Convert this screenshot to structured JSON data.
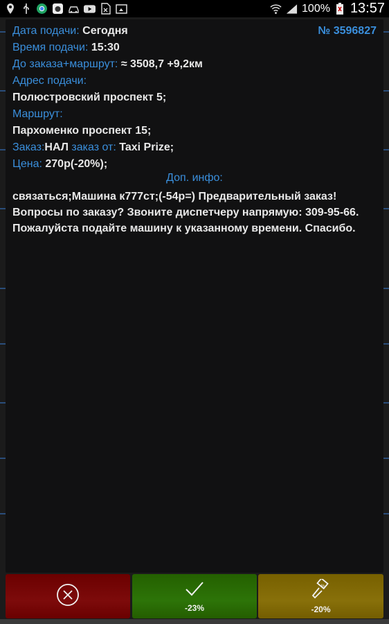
{
  "status_bar": {
    "battery": "100%",
    "time": "13:57"
  },
  "order": {
    "date_label": "Дата подачи:",
    "date_value": "Сегодня",
    "order_number": "№ 3596827",
    "time_label": "Время подачи:",
    "time_value": "15:30",
    "distance_label": "До заказа+маршрут:",
    "distance_value": "≈ 3508,7 +9,2км",
    "address_label": "Адрес подачи:",
    "address_value": "Полюстровский проспект 5;",
    "route_label": "Маршрут:",
    "route_value": "Пархоменко проспект 15;",
    "order_label": "Заказ:",
    "order_type": "НАЛ",
    "order_from_label": "заказ от:",
    "order_from_value": "Taxi Prize;",
    "price_label": "Цена:",
    "price_value": "270р(-20%);",
    "info_title": "Доп. инфо:",
    "info_text": "связаться;Машина к777ст;(-54р=)  Предварительный заказ! Вопросы по заказу? Звоните диспетчеру напрямую: 309-95-66. Пожалуйста подайте машину к указанному времени. Спасибо."
  },
  "buttons": {
    "accept_discount": "-23%",
    "bid_discount": "-20%"
  },
  "colors": {
    "label": "#3a8fdc",
    "cancel": "#7d0b0b",
    "accept": "#2d7408",
    "bid": "#88700a"
  }
}
